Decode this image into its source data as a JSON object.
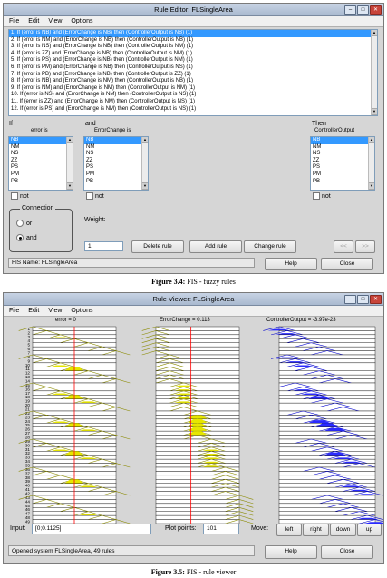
{
  "rule_editor": {
    "title": "Rule Editor: FLSingleArea",
    "menu": [
      "File",
      "Edit",
      "View",
      "Options"
    ],
    "rules": [
      "1. If (error is NB) and (ErrorChange is NB) then (ControllerOutput is NB) (1)",
      "2. If (error is NM) and (ErrorChange is NB) then (ControllerOutput is NB) (1)",
      "3. If (error is NS) and (ErrorChange is NB) then (ControllerOutput is NM) (1)",
      "4. If (error is ZZ) and (ErrorChange is NB) then (ControllerOutput is NM) (1)",
      "5. If (error is PS) and (ErrorChange is NB) then (ControllerOutput is NM) (1)",
      "6. If (error is PM) and (ErrorChange is NB) then (ControllerOutput is NS) (1)",
      "7. If (error is PB) and (ErrorChange is NB) then (ControllerOutput is ZZ) (1)",
      "8. If (error is NB) and (ErrorChange is NM) then (ControllerOutput is NB) (1)",
      "9. If (error is NM) and (ErrorChange is NM) then (ControllerOutput is NM) (1)",
      "10. If (error is NS) and (ErrorChange is NM) then (ControllerOutput is NS) (1)",
      "11. If (error is ZZ) and (ErrorChange is NM) then (ControllerOutput is NS) (1)",
      "12. If (error is PS) and (ErrorChange is NM) then (ControllerOutput is NS) (1)"
    ],
    "if_label": "If",
    "and_label": "and",
    "then_label": "Then",
    "input1_name": "error is",
    "input2_name": "ErrorChange is",
    "output_name": "ControllerOutput",
    "mf_options": [
      "NB",
      "NM",
      "NS",
      "ZZ",
      "PS",
      "PM",
      "PB"
    ],
    "not_label": "not",
    "connection_label": "Connection",
    "or_label": "or",
    "and_option_label": "and",
    "weight_label": "Weight:",
    "weight_value": "1",
    "delete_rule": "Delete rule",
    "add_rule": "Add rule",
    "change_rule": "Change rule",
    "prev_btn": "<<",
    "next_btn": ">>",
    "status": "FIS Name: FLSingleArea",
    "help": "Help",
    "close": "Close"
  },
  "caption1": {
    "bold": "Figure 3.4:",
    "text": " FIS - fuzzy rules"
  },
  "rule_viewer": {
    "title": "Rule Viewer: FLSingleArea",
    "menu": [
      "File",
      "Edit",
      "View",
      "Options"
    ],
    "col1_header": "error = 0",
    "col2_header": "ErrorChange = 0.113",
    "col3_header": "ControllerOutput = -3.97e-23",
    "row_count": 49,
    "input_label": "Input:",
    "input_value": "[0;0.1125]",
    "plot_points_label": "Plot points:",
    "plot_points_value": "101",
    "move_label": "Move:",
    "left": "left",
    "right": "right",
    "down": "down",
    "up": "up",
    "status": "Opened system FLSingleArea, 49 rules",
    "help": "Help",
    "close": "Close",
    "colors": {
      "input_fill": "#e6e600",
      "output_fill": "#2a2aff",
      "index_line": "#ff0000"
    }
  },
  "caption2": {
    "bold": "Figure 3.5:",
    "text": " FIS - rule viewer"
  }
}
